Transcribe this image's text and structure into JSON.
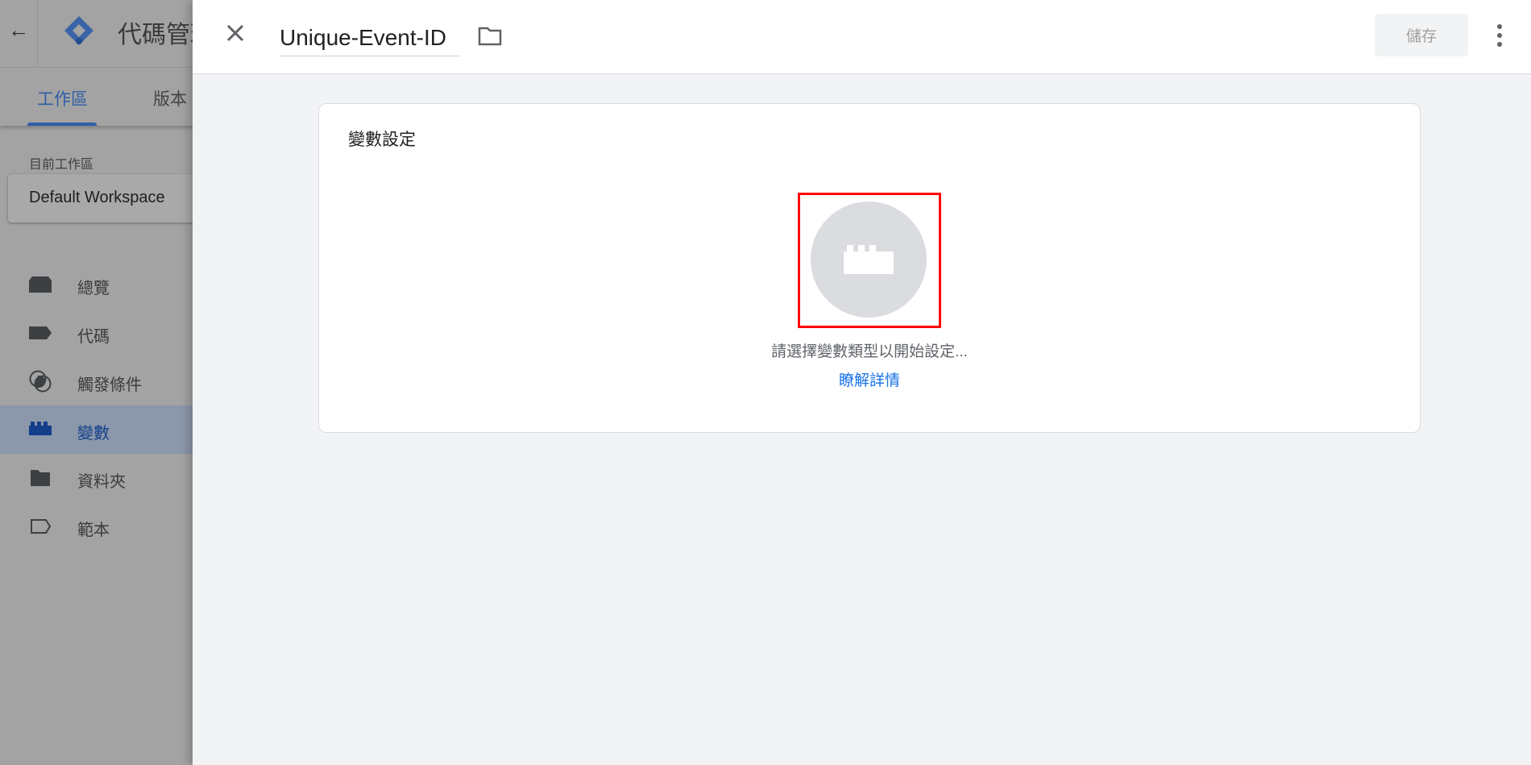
{
  "sidebar": {
    "app_title": "代碼管理工具",
    "tabs": [
      {
        "label": "工作區",
        "active": true
      },
      {
        "label": "版本",
        "active": false
      }
    ],
    "workspace_label": "目前工作區",
    "workspace_name": "Default Workspace",
    "items": [
      {
        "label": "總覽",
        "icon": "overview-icon"
      },
      {
        "label": "代碼",
        "icon": "tag-icon"
      },
      {
        "label": "觸發條件",
        "icon": "trigger-icon"
      },
      {
        "label": "變數",
        "icon": "variable-brick-icon",
        "active": true
      },
      {
        "label": "資料夾",
        "icon": "folder-icon"
      },
      {
        "label": "範本",
        "icon": "template-icon"
      }
    ]
  },
  "panel": {
    "name_value": "Unique-Event-ID",
    "save_label": "儲存",
    "card_title": "變數設定",
    "hint": "請選擇變數類型以開始設定...",
    "learn_more": "瞭解詳情"
  },
  "colors": {
    "accent": "#1a73e8",
    "highlight_box": "#ff0000",
    "active_nav": "#123e8a"
  }
}
